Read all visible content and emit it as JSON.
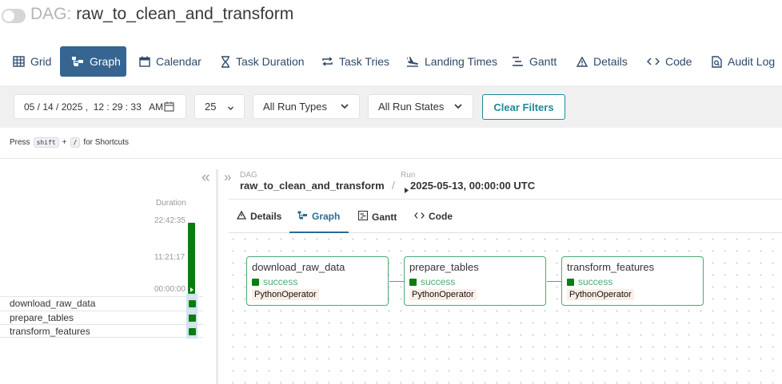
{
  "header": {
    "toggle_state": "off",
    "prefix": "DAG:",
    "dag_name": "raw_to_clean_and_transform"
  },
  "nav": {
    "items": [
      {
        "label": "Grid",
        "icon": "grid-icon"
      },
      {
        "label": "Graph",
        "icon": "graph-icon",
        "active": true
      },
      {
        "label": "Calendar",
        "icon": "calendar-icon"
      },
      {
        "label": "Task Duration",
        "icon": "hourglass-icon"
      },
      {
        "label": "Task Tries",
        "icon": "retry-icon"
      },
      {
        "label": "Landing Times",
        "icon": "plane-landing-icon"
      },
      {
        "label": "Gantt",
        "icon": "gantt-icon"
      },
      {
        "label": "Details",
        "icon": "warning-triangle-icon"
      },
      {
        "label": "Code",
        "icon": "code-icon"
      },
      {
        "label": "Audit Log",
        "icon": "audit-search-icon"
      }
    ]
  },
  "filters": {
    "date_value": "05 / 14 / 2025 ,  12 : 29 : 33   AM",
    "run_count": "25",
    "run_types": "All Run Types",
    "run_states": "All Run States",
    "clear_label": "Clear Filters"
  },
  "shortcut": {
    "press": "Press",
    "key1": "shift",
    "plus": "+",
    "key2": "/",
    "suffix": "for Shortcuts"
  },
  "grid": {
    "duration_label": "Duration",
    "ticks": [
      "22:42:35",
      "11:21:17",
      "00:00:00"
    ],
    "run_duration_fraction": 1.0,
    "tasks": [
      {
        "name": "download_raw_data",
        "state": "success"
      },
      {
        "name": "prepare_tables",
        "state": "success"
      },
      {
        "name": "transform_features",
        "state": "success"
      }
    ]
  },
  "breadcrumb": {
    "dag_label": "DAG",
    "dag_name": "raw_to_clean_and_transform",
    "separator": "/",
    "run_label": "Run",
    "run_value": "2025-05-13, 00:00:00 UTC"
  },
  "tabs": [
    {
      "label": "Details",
      "icon": "warning-triangle-icon"
    },
    {
      "label": "Graph",
      "icon": "graph-icon",
      "active": true
    },
    {
      "label": "Gantt",
      "icon": "gantt-icon"
    },
    {
      "label": "Code",
      "icon": "code-icon"
    }
  ],
  "graph": {
    "nodes": [
      {
        "name": "download_raw_data",
        "state": "success",
        "operator": "PythonOperator"
      },
      {
        "name": "prepare_tables",
        "state": "success",
        "operator": "PythonOperator"
      },
      {
        "name": "transform_features",
        "state": "success",
        "operator": "PythonOperator"
      }
    ]
  },
  "colors": {
    "primary": "#366591",
    "success": "#0a7d11",
    "success_border": "#4caa74",
    "teal": "#1f8a99"
  }
}
